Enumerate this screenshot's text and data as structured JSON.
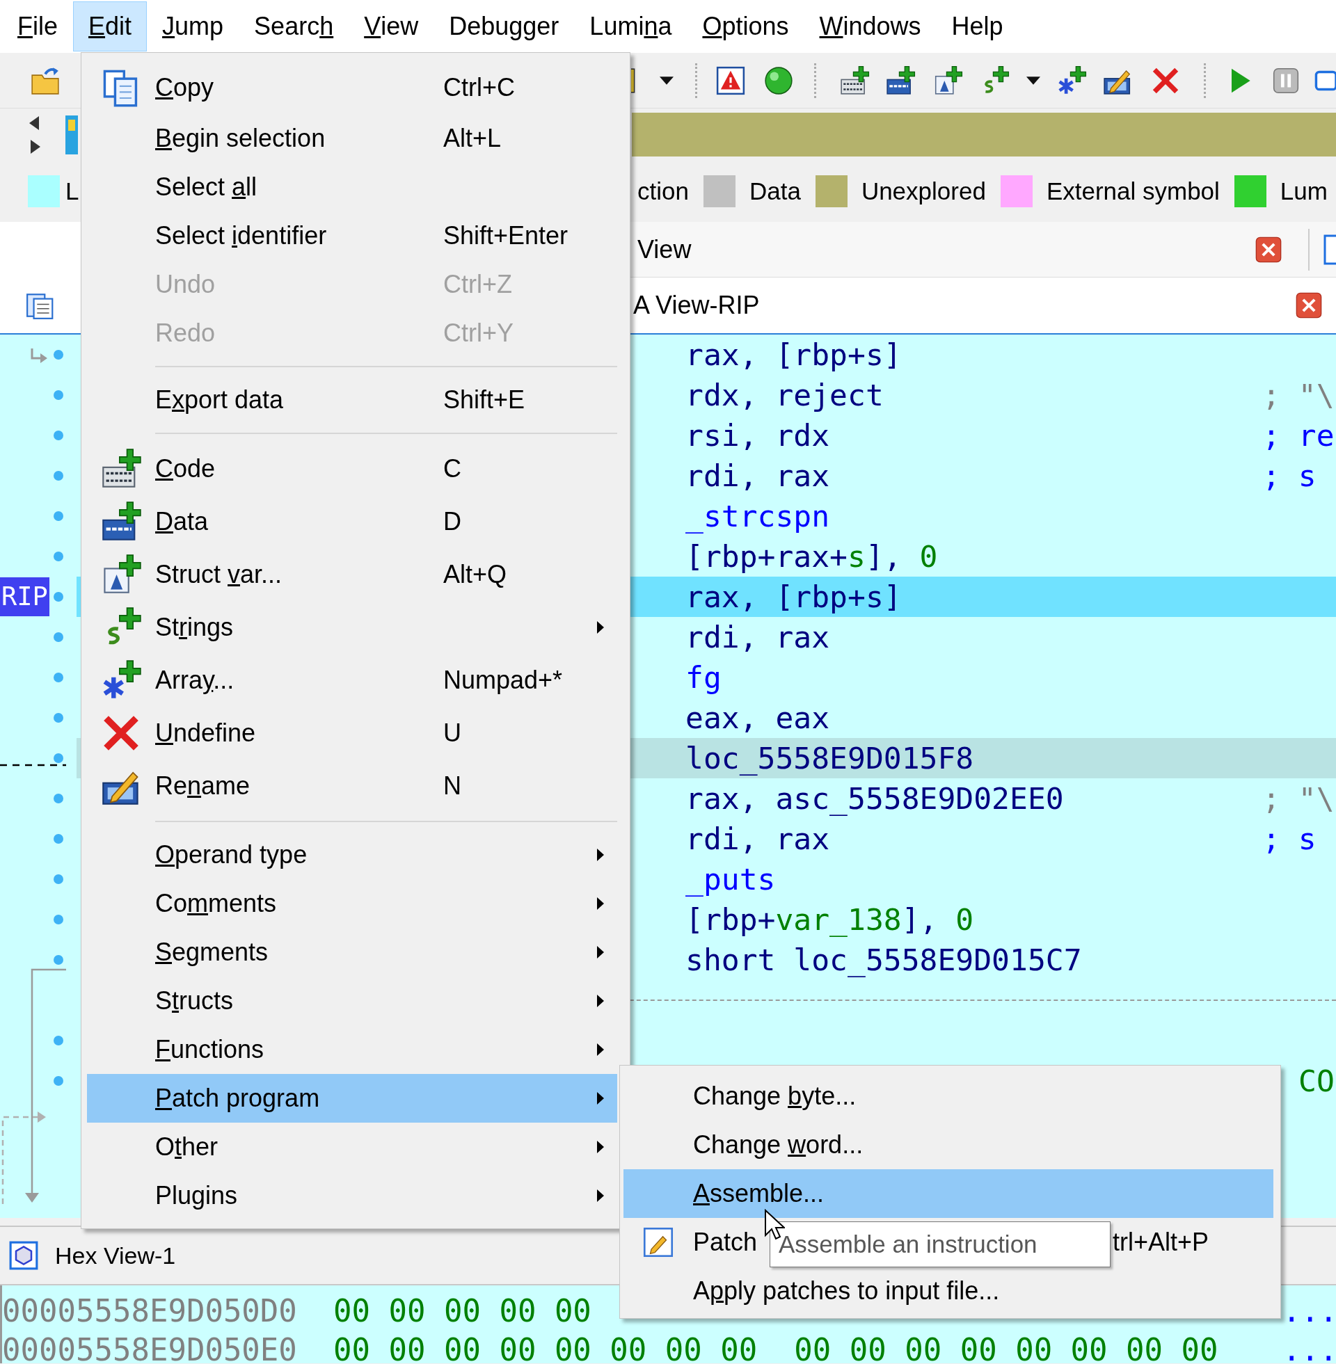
{
  "menubar": [
    {
      "label": {
        "key": "F",
        "after": "ile"
      },
      "selected": false
    },
    {
      "label": {
        "key": "E",
        "after": "dit"
      },
      "selected": true
    },
    {
      "label": {
        "key": "J",
        "after": "ump"
      },
      "selected": false
    },
    {
      "label": {
        "before": "Searc",
        "key": "h"
      },
      "selected": false
    },
    {
      "label": {
        "key": "V",
        "after": "iew"
      },
      "selected": false
    },
    {
      "label": {
        "before": "Debu",
        "key": "g",
        "after": "ger"
      },
      "selected": false
    },
    {
      "label": {
        "before": "Lumi",
        "key": "n",
        "after": "a"
      },
      "selected": false
    },
    {
      "label": {
        "key": "O",
        "after": "ptions"
      },
      "selected": false
    },
    {
      "label": {
        "key": "W",
        "after": "indows"
      },
      "selected": false
    },
    {
      "label": {
        "before": "Help"
      },
      "selected": false
    }
  ],
  "legend": {
    "items": [
      {
        "label": "L",
        "color": "#aaffff"
      },
      {
        "label": "ction"
      },
      {
        "label": "Data",
        "color": "#c0c0c0"
      },
      {
        "label": "Unexplored",
        "color": "#b4b26c"
      },
      {
        "label": "External symbol",
        "color": "#ffa8ff"
      },
      {
        "label": "Lum",
        "color": "#30d030"
      }
    ]
  },
  "tabs": {
    "view_tab": "View",
    "disasm_title": "A View-RIP"
  },
  "disasm": {
    "lines": [
      {
        "kind": "code",
        "selected": false,
        "parts": [
          {
            "text": "rax, [rbp+s]",
            "kind": "text"
          }
        ]
      },
      {
        "kind": "code",
        "selected": false,
        "parts": [
          {
            "text": "rdx, reject",
            "kind": "text"
          }
        ],
        "comment": {
          "text": "; \"\\",
          "kind": "string"
        }
      },
      {
        "kind": "code",
        "selected": false,
        "parts": [
          {
            "text": "rsi, rdx",
            "kind": "text"
          }
        ],
        "comment": {
          "text": "; re",
          "kind": "ref"
        }
      },
      {
        "kind": "code",
        "selected": false,
        "parts": [
          {
            "text": "rdi, rax",
            "kind": "text"
          }
        ],
        "comment": {
          "text": "; s",
          "kind": "ref"
        }
      },
      {
        "kind": "code",
        "selected": false,
        "parts": [
          {
            "text": "_strcspn",
            "kind": "name"
          }
        ]
      },
      {
        "kind": "code",
        "selected": false,
        "parts": [
          {
            "text": "[rbp+rax+",
            "kind": "text"
          },
          {
            "text": "s",
            "kind": "var"
          },
          {
            "text": "], ",
            "kind": "text"
          },
          {
            "text": "0",
            "kind": "num"
          }
        ]
      },
      {
        "kind": "code",
        "selected": true,
        "marker": "RIP",
        "parts": [
          {
            "text": "rax, [rbp+s]",
            "kind": "text"
          }
        ]
      },
      {
        "kind": "code",
        "selected": false,
        "parts": [
          {
            "text": "rdi, rax",
            "kind": "text"
          }
        ]
      },
      {
        "kind": "code",
        "selected": false,
        "parts": [
          {
            "text": "fg",
            "kind": "name"
          }
        ]
      },
      {
        "kind": "code",
        "selected": false,
        "parts": [
          {
            "text": "eax, eax",
            "kind": "text"
          }
        ]
      },
      {
        "kind": "label",
        "selected": false,
        "parts": [
          {
            "text": "loc_5558E9D015F8",
            "kind": "text"
          }
        ]
      },
      {
        "kind": "code",
        "selected": false,
        "parts": [
          {
            "text": "rax, asc_5558E9D02EE0",
            "kind": "text"
          }
        ],
        "comment": {
          "text": "; \"\\",
          "kind": "string"
        }
      },
      {
        "kind": "code",
        "selected": false,
        "parts": [
          {
            "text": "rdi, rax",
            "kind": "text"
          }
        ],
        "comment": {
          "text": "; s",
          "kind": "ref"
        }
      },
      {
        "kind": "code",
        "selected": false,
        "parts": [
          {
            "text": "_puts",
            "kind": "name"
          }
        ]
      },
      {
        "kind": "code",
        "selected": false,
        "parts": [
          {
            "text": "[rbp+",
            "kind": "text"
          },
          {
            "text": "var_138",
            "kind": "var"
          },
          {
            "text": "], ",
            "kind": "text"
          },
          {
            "text": "0",
            "kind": "num"
          }
        ]
      },
      {
        "kind": "code",
        "selected": false,
        "parts": [
          {
            "text": "short loc_5558E9D015C7",
            "kind": "text"
          }
        ]
      },
      {
        "kind": "separator",
        "selected": false
      },
      {
        "kind": "blank",
        "selected": false
      },
      {
        "kind": "code",
        "selected": false,
        "comment": {
          "text": "CO",
          "kind": "xref"
        }
      }
    ]
  },
  "hexview": {
    "title": "Hex View-1",
    "rows": [
      {
        "address": "00005558E9D050D0",
        "bytes": "00 00 00 00 00",
        "ascii": "..."
      },
      {
        "address": "00005558E9D050E0",
        "bytes": "00 00 00 00 00 00 00 00  00 00 00 00 00 00 00 00",
        "ascii": "..."
      }
    ]
  },
  "edit_menu": {
    "items": [
      {
        "kind": "copy",
        "label": {
          "key": "C",
          "after": "opy"
        },
        "shortcut": "Ctrl+C",
        "submenu": false,
        "disabled": false,
        "selected": false
      },
      {
        "kind": "item",
        "label": {
          "key": "B",
          "after": "egin selection"
        },
        "shortcut": "Alt+L",
        "submenu": false,
        "disabled": false,
        "selected": false
      },
      {
        "kind": "item",
        "label": {
          "before": "Select ",
          "key": "a",
          "after": "ll"
        },
        "submenu": false,
        "disabled": false,
        "selected": false
      },
      {
        "kind": "item",
        "label": {
          "before": "Select ",
          "key": "i",
          "after": "dentifier"
        },
        "shortcut": "Shift+Enter",
        "submenu": false,
        "disabled": false,
        "selected": false
      },
      {
        "kind": "item",
        "label": {
          "before": "Undo"
        },
        "shortcut": "Ctrl+Z",
        "submenu": false,
        "disabled": true,
        "selected": false
      },
      {
        "kind": "item",
        "label": {
          "before": "Redo"
        },
        "shortcut": "Ctrl+Y",
        "submenu": false,
        "disabled": true,
        "selected": false
      },
      {
        "kind": "separator"
      },
      {
        "kind": "item",
        "label": {
          "before": "E",
          "key": "x",
          "after": "port data"
        },
        "shortcut": "Shift+E",
        "submenu": false,
        "disabled": false,
        "selected": false
      },
      {
        "kind": "separator"
      },
      {
        "kind": "code",
        "label": {
          "key": "C",
          "after": "ode"
        },
        "shortcut": "C",
        "submenu": false,
        "disabled": false,
        "selected": false
      },
      {
        "kind": "data",
        "label": {
          "key": "D",
          "after": "ata"
        },
        "shortcut": "D",
        "submenu": false,
        "disabled": false,
        "selected": false
      },
      {
        "kind": "struct",
        "label": {
          "before": "Struct ",
          "key": "v",
          "after": "ar..."
        },
        "shortcut": "Alt+Q",
        "submenu": false,
        "disabled": false,
        "selected": false
      },
      {
        "kind": "strings",
        "label": {
          "before": "St",
          "key": "r",
          "after": "ings"
        },
        "submenu": true,
        "disabled": false,
        "selected": false
      },
      {
        "kind": "array",
        "label": {
          "before": "Arra",
          "key": "y",
          "after": "..."
        },
        "shortcut": "Numpad+*",
        "submenu": false,
        "disabled": false,
        "selected": false
      },
      {
        "kind": "undefine",
        "label": {
          "key": "U",
          "after": "ndefine"
        },
        "shortcut": "U",
        "submenu": false,
        "disabled": false,
        "selected": false
      },
      {
        "kind": "rename",
        "label": {
          "before": "Re",
          "key": "n",
          "after": "ame"
        },
        "shortcut": "N",
        "submenu": false,
        "disabled": false,
        "selected": false
      },
      {
        "kind": "separator"
      },
      {
        "kind": "item",
        "label": {
          "key": "O",
          "after": "perand type"
        },
        "submenu": true,
        "disabled": false,
        "selected": false
      },
      {
        "kind": "item",
        "label": {
          "before": "Co",
          "key": "m",
          "after": "ments"
        },
        "submenu": true,
        "disabled": false,
        "selected": false
      },
      {
        "kind": "item",
        "label": {
          "key": "S",
          "after": "egments"
        },
        "submenu": true,
        "disabled": false,
        "selected": false
      },
      {
        "kind": "item",
        "label": {
          "before": "S",
          "key": "t",
          "after": "ructs"
        },
        "submenu": true,
        "disabled": false,
        "selected": false
      },
      {
        "kind": "item",
        "label": {
          "key": "F",
          "after": "unctions"
        },
        "submenu": true,
        "disabled": false,
        "selected": false
      },
      {
        "kind": "item",
        "label": {
          "key": "P",
          "after": "atch program"
        },
        "submenu": true,
        "disabled": false,
        "selected": true
      },
      {
        "kind": "item",
        "label": {
          "before": "O",
          "key": "t",
          "after": "her"
        },
        "submenu": true,
        "disabled": false,
        "selected": false
      },
      {
        "kind": "item",
        "label": {
          "before": "Plu",
          "key": "g",
          "after": "ins"
        },
        "submenu": true,
        "disabled": false,
        "selected": false
      }
    ]
  },
  "patch_submenu": {
    "items": [
      {
        "kind": "item",
        "label": {
          "before": "Change ",
          "key": "b",
          "after": "yte..."
        },
        "disabled": false,
        "selected": false
      },
      {
        "kind": "item",
        "label": {
          "before": "Change ",
          "key": "w",
          "after": "ord..."
        },
        "disabled": false,
        "selected": false
      },
      {
        "kind": "item",
        "label": {
          "key": "A",
          "after": "ssemble..."
        },
        "disabled": false,
        "selected": true
      },
      {
        "kind": "patch",
        "label": {
          "before": "Patch"
        },
        "shortcut": "trl+Alt+P",
        "disabled": false,
        "selected": false
      },
      {
        "kind": "item",
        "label": {
          "before": "A",
          "key": "p",
          "after": "ply patches to input file..."
        },
        "disabled": false,
        "selected": false
      }
    ]
  },
  "tooltip": {
    "text": "Assemble an instruction"
  }
}
